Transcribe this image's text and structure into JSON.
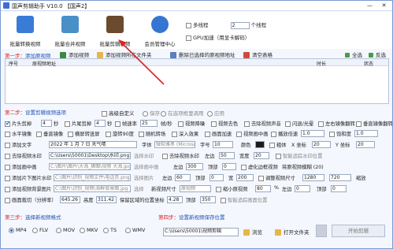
{
  "app": {
    "title": "国声剪辑助手 V10.0   【国声2】",
    "win_min": "—",
    "win_close": "✕"
  },
  "toolbar": {
    "buttons": [
      {
        "label": "批量转换视频",
        "icon": "convert-video-icon",
        "color": "#3a7bd5"
      },
      {
        "label": "批量合并视频",
        "icon": "merge-video-icon",
        "color": "#4a90c8"
      },
      {
        "label": "批量剪辑视频",
        "icon": "film-scissors-icon",
        "color": "#6b4a2e"
      },
      {
        "label": "会员管理中心",
        "icon": "member-center-icon",
        "color": "#3576d3"
      }
    ],
    "opt_multi_thread": "多线程",
    "opt_thread_count": "2",
    "opt_thread_unit": "个线程",
    "opt_gpu": "GPU加速（用显卡解码）"
  },
  "step1": {
    "label_prefix": "第一步：",
    "label": "添加原视频",
    "add_video": "添加视频",
    "add_folder": "添加视频所在文件夹",
    "delete_selected": "删除已选择的原视频地址",
    "clear_table": "清空表格",
    "select_all": "全选",
    "invert": "反选"
  },
  "table": {
    "columns": [
      "序号",
      "原视频地址",
      "时长",
      "状态"
    ]
  },
  "step2": {
    "label_prefix": "第二步：",
    "label": "设置剪辑视频选项",
    "auto_define": "高级自定义",
    "save": "保存",
    "apply_all": "在选项框里调用",
    "apply": "应用"
  },
  "options": {
    "r1": {
      "cut_head": "片头剪掉",
      "cut_head_v": "4",
      "sec": "秒",
      "cut_tail": "片尾剪掉",
      "cut_tail_v": "4",
      "sec2": "秒",
      "framerate": "帧速率",
      "framerate_v": "25",
      "fps": "帧/秒",
      "denoise": "视频降噪",
      "sharpen": "视频去色",
      "remove_audio": "去除视频声音",
      "flash": "闪退/光晕",
      "mirror": "左右镜像翻转",
      "flip": "垂直镜像翻转"
    },
    "r2": {
      "hmirror": "水平镜像",
      "vmirror": "垂直镜像",
      "clip_reverse": "横屏转竖屏",
      "rotate": "旋转90度",
      "random": "随机转场",
      "blur": "深入效果",
      "fast": "画面加速",
      "slowmo": "视频画中画",
      "speed": "调整速度",
      "playspeed": "播放倍速",
      "playspeed_v": "1.0",
      "sat": "饱和度",
      "sat_v": "1.0",
      "hue": "色调等级（度）"
    },
    "r3": {
      "add_text": "添加文字",
      "text_v": "2022 年 1 月 7 日 天气晴",
      "font": "字体",
      "font_v": "微软雅黑 (Microsoft YaHei)",
      "size": "字号",
      "size_v": "10",
      "color": "颜色",
      "bold": "粗体",
      "pos_x": "X 坐标",
      "pos_x_v": "20",
      "pos_y": "Y 坐标",
      "pos_y_v": "20"
    },
    "r4": {
      "add_logo": "去除视频水印",
      "logo_v": "C:\\Users\\50001\\Desktop\\水印.png",
      "pick_logo": "选择水印",
      "remove_water": "去除视频水印",
      "left": "左边",
      "left_v": "50",
      "right": "宽度",
      "right_v": "20",
      "opacity": "透明度",
      "mark_pos": "智能追踪水印位置"
    },
    "r5": {
      "add_pip": "添加画中画",
      "pip_v": "C:\\图片\\图片\\大海_狮图\\视频 大海.jpg",
      "pick_pip": "选择画中画",
      "left": "左边",
      "left_v": "300",
      "top": "顶部",
      "top_v": "0",
      "virtual": "虚化边框视频",
      "virtual_v": "将原视频模糊 (20)",
      "desc": "模糊"
    },
    "r6": {
      "add_effect": "添加片下图片水印",
      "effect_v": "C:\\图片\\识别_视频文件\\电话页.png",
      "pick": "选择图片",
      "left": "左边",
      "left_v": "60",
      "top": "顶部",
      "top_v": "0",
      "width": "宽",
      "width_v": "200",
      "adjust": "调整视频尺寸",
      "w_v": "1280",
      "h_v": "720",
      "pct": "缩放"
    },
    "r7": {
      "add_bg": "添加视频背景图片",
      "bg_v": "C:\\图片\\识别_视频\\海鲜背景图.jpg",
      "pick": "选择",
      "time": "新视频尺寸",
      "time_v": "原视频",
      "adjust": "缩小原视频",
      "adjust_v": "80",
      "pct": "%",
      "left": "左边",
      "left_v": "0",
      "top": "顶部",
      "top_v": "0"
    },
    "r8": {
      "fade": "画面裁切（分辨率）",
      "fade_v": "645.26",
      "start": "高度",
      "start_v": "311.42",
      "keep": "保留区域的位置坐标",
      "keep_v": "4.28",
      "end": "顶部",
      "end_v": "350",
      "track": "智能追踪画面位置"
    }
  },
  "step3": {
    "label_prefix": "第三步：",
    "label": "选择新视频格式",
    "formats": [
      "MP4",
      "FLV",
      "MOV",
      "MKV",
      "TS",
      "WMV"
    ],
    "selected": "MP4"
  },
  "step4": {
    "label_prefix": "第四步：",
    "label": "设置新视频保存位置",
    "path": "C:\\Users\\50001\\视频剪辑",
    "browse": "浏览",
    "open_folder": "打开文件夹",
    "start": "开始剪辑"
  }
}
